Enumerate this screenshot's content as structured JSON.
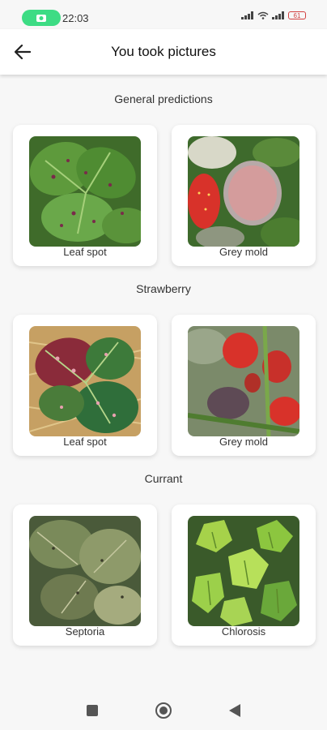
{
  "status_bar": {
    "time": "22:03",
    "battery": "61"
  },
  "app_bar": {
    "title": "You took pictures"
  },
  "sections": [
    {
      "title": "General predictions",
      "items": [
        {
          "label": "Leaf spot",
          "icon": "leaf-spot-photo"
        },
        {
          "label": "Grey mold",
          "icon": "grey-mold-photo"
        }
      ]
    },
    {
      "title": "Strawberry",
      "items": [
        {
          "label": "Leaf spot",
          "icon": "leaf-spot-photo"
        },
        {
          "label": "Grey mold",
          "icon": "grey-mold-photo"
        }
      ]
    },
    {
      "title": "Currant",
      "items": [
        {
          "label": "Septoria",
          "icon": "septoria-photo"
        },
        {
          "label": "Chlorosis",
          "icon": "chlorosis-photo"
        }
      ]
    }
  ],
  "colors": {
    "background": "#f7f7f7",
    "card": "#ffffff",
    "accent_green": "#3ddc84"
  }
}
